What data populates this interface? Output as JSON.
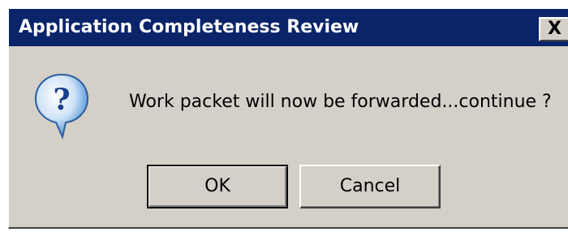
{
  "dialog": {
    "title": "Application Completeness Review",
    "close_label": "X",
    "message": "Work packet will now be forwarded...continue ?",
    "icon": "question-icon",
    "buttons": {
      "ok_label": "OK",
      "cancel_label": "Cancel"
    }
  },
  "colors": {
    "titlebar": "#0a246a",
    "title_text": "#ffffff",
    "dialog_background": "#d4d0c8",
    "icon_bubble": "#4a8fd6"
  }
}
